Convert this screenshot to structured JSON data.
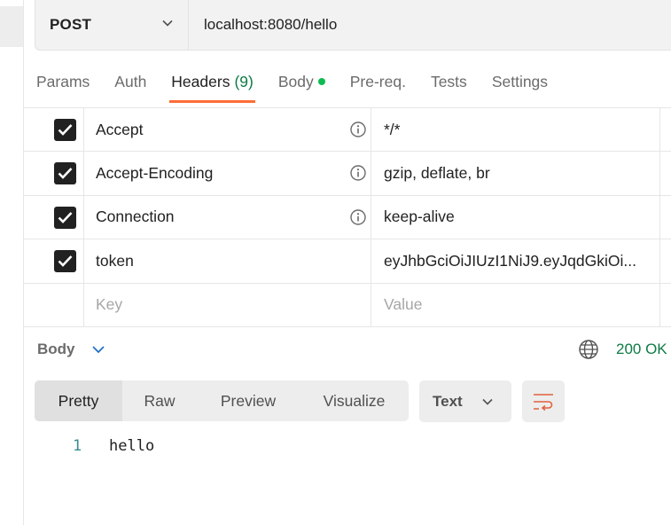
{
  "request": {
    "method": "POST",
    "url": "localhost:8080/hello"
  },
  "tabs": [
    {
      "label": "Params"
    },
    {
      "label": "Auth"
    },
    {
      "label": "Headers",
      "count": "(9)",
      "active": true
    },
    {
      "label": "Body",
      "indicator": "dot"
    },
    {
      "label": "Pre-req."
    },
    {
      "label": "Tests"
    },
    {
      "label": "Settings"
    }
  ],
  "headers": [
    {
      "checked": true,
      "key": "Accept",
      "info": true,
      "value": "*/*"
    },
    {
      "checked": true,
      "key": "Accept-Encoding",
      "info": true,
      "value": "gzip, deflate, br"
    },
    {
      "checked": true,
      "key": "Connection",
      "info": true,
      "value": "keep-alive"
    },
    {
      "checked": true,
      "key": "token",
      "info": false,
      "value": "eyJhbGciOiJIUzI1NiJ9.eyJqdGkiOi..."
    }
  ],
  "new_row": {
    "key_placeholder": "Key",
    "value_placeholder": "Value"
  },
  "response": {
    "title": "Body",
    "status": "200 OK",
    "views": [
      "Pretty",
      "Raw",
      "Preview",
      "Visualize"
    ],
    "active_view": "Pretty",
    "format": "Text",
    "lines": [
      {
        "number": "1",
        "text": "hello"
      }
    ]
  },
  "colors": {
    "accent": "#ff6c37",
    "status_ok": "#0e7a45",
    "body_dot": "#0cbb52",
    "line_number": "#3b8a92"
  },
  "icons": [
    "chevron-down-icon",
    "checkmark-icon",
    "info-icon",
    "globe-icon",
    "wrap-lines-icon"
  ]
}
